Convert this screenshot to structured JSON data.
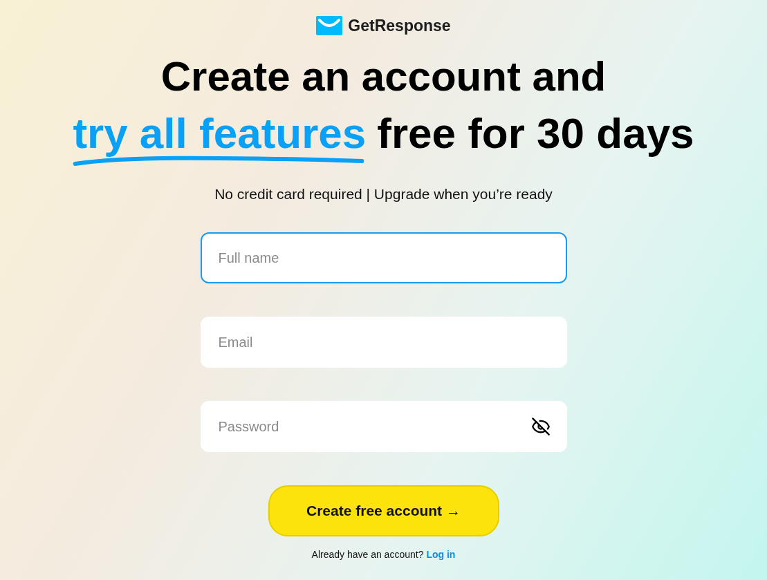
{
  "logo": {
    "text": "GetResponse"
  },
  "headline": {
    "line_1": "Create an account and",
    "highlight": "try all features",
    "line_2_rest": "free for 30 days"
  },
  "subtitle": "No credit card required | Upgrade when you’re ready",
  "fields": [
    {
      "kind": "text",
      "placeholder": "Full name",
      "focused": true
    },
    {
      "kind": "email",
      "placeholder": "Email",
      "focused": false
    },
    {
      "kind": "password",
      "placeholder": "Password",
      "focused": false
    }
  ],
  "submit": {
    "label": "Create free account",
    "arrow": "→"
  },
  "login": {
    "prompt": "Already have an account?",
    "link": "Log in"
  }
}
